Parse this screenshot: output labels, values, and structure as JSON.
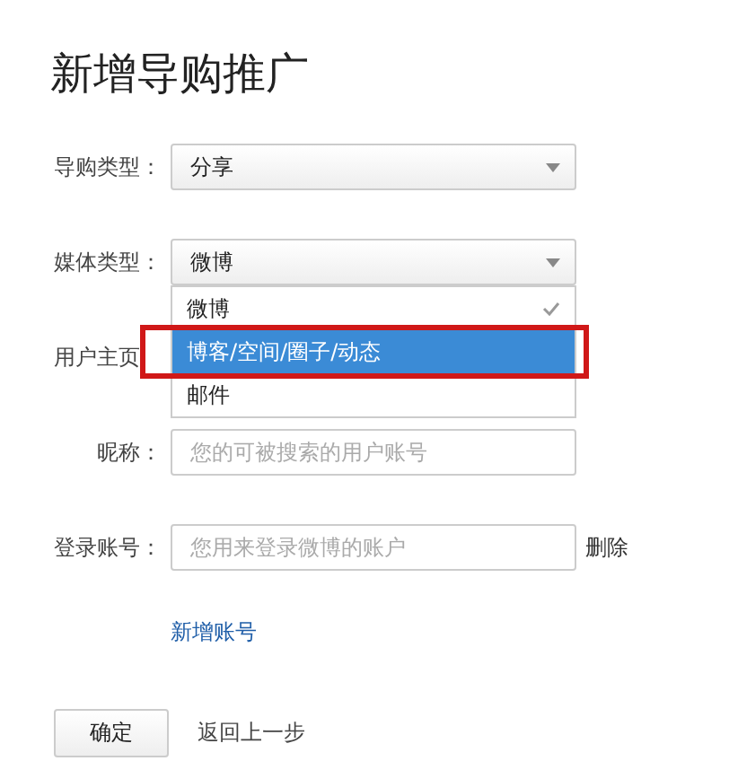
{
  "title": "新增导购推广",
  "fields": [
    {
      "label": "导购类型：",
      "kind": "select",
      "value": "分享"
    },
    {
      "label": "媒体类型：",
      "kind": "select",
      "value": "微博",
      "open": true,
      "options": [
        {
          "label": "微博",
          "selected": true,
          "hovered": false
        },
        {
          "label": "博客/空间/圈子/动态",
          "selected": false,
          "hovered": true,
          "highlighted": true
        },
        {
          "label": "邮件",
          "selected": false,
          "hovered": false
        }
      ]
    },
    {
      "label": "用户主页",
      "kind": "hidden"
    },
    {
      "label": "昵称：",
      "kind": "input",
      "placeholder": "您的可被搜索的用户账号"
    },
    {
      "label": "登录账号：",
      "kind": "input",
      "placeholder": "您用来登录微博的账户",
      "action": "删除"
    }
  ],
  "add_link": "新增账号",
  "submit": "确定",
  "back": "返回上一步"
}
